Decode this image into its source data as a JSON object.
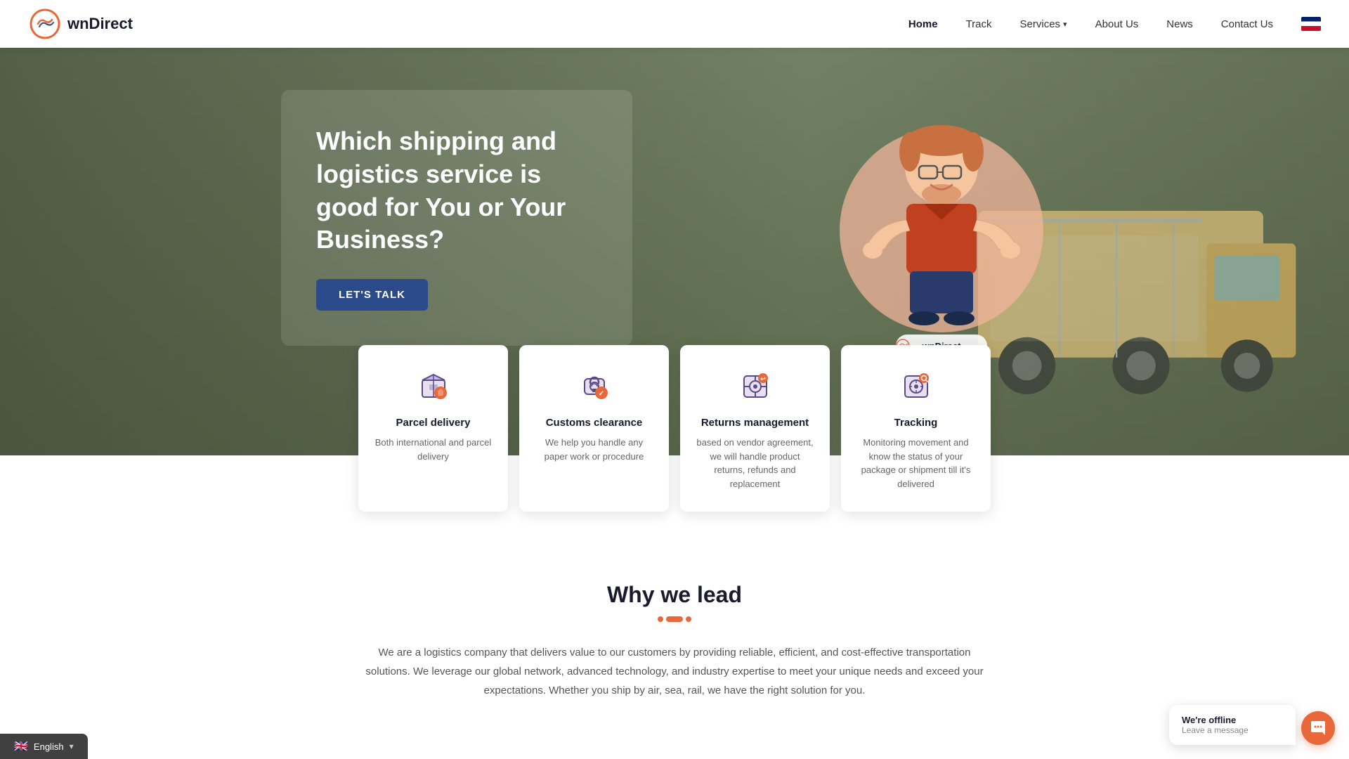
{
  "nav": {
    "logo_text": "wnDirect",
    "links": [
      {
        "label": "Home",
        "active": true,
        "id": "home"
      },
      {
        "label": "Track",
        "active": false,
        "id": "track"
      },
      {
        "label": "Services",
        "active": false,
        "id": "services",
        "has_dropdown": true
      },
      {
        "label": "About Us",
        "active": false,
        "id": "about"
      },
      {
        "label": "News",
        "active": false,
        "id": "news"
      },
      {
        "label": "Contact Us",
        "active": false,
        "id": "contact"
      }
    ]
  },
  "hero": {
    "title": "Which shipping and logistics service is good for You or Your Business?",
    "cta_label": "LET'S TALK",
    "mascot_label": "wnDirect"
  },
  "services": [
    {
      "id": "parcel-delivery",
      "title": "Parcel delivery",
      "desc": "Both international and parcel delivery",
      "icon": "parcel"
    },
    {
      "id": "customs-clearance",
      "title": "Customs clearance",
      "desc": "We help you handle any paper work or procedure",
      "icon": "customs"
    },
    {
      "id": "returns-management",
      "title": "Returns management",
      "desc": "based on vendor agreement, we will handle product returns, refunds and replacement",
      "icon": "returns"
    },
    {
      "id": "tracking",
      "title": "Tracking",
      "desc": "Monitoring movement and know the status of your package or shipment till it's delivered",
      "icon": "tracking"
    }
  ],
  "why_section": {
    "title": "Why we lead",
    "body": "We are a logistics company that delivers value to our customers by providing reliable, efficient, and cost-effective transportation solutions. We leverage our global network, advanced technology, and industry expertise to meet your unique needs and exceed your expectations. Whether you ship by air, sea, rail, we have the right solution for you."
  },
  "chat_widget": {
    "title": "We're offline",
    "subtitle": "Leave a message"
  },
  "lang_bar": {
    "label": "English"
  }
}
